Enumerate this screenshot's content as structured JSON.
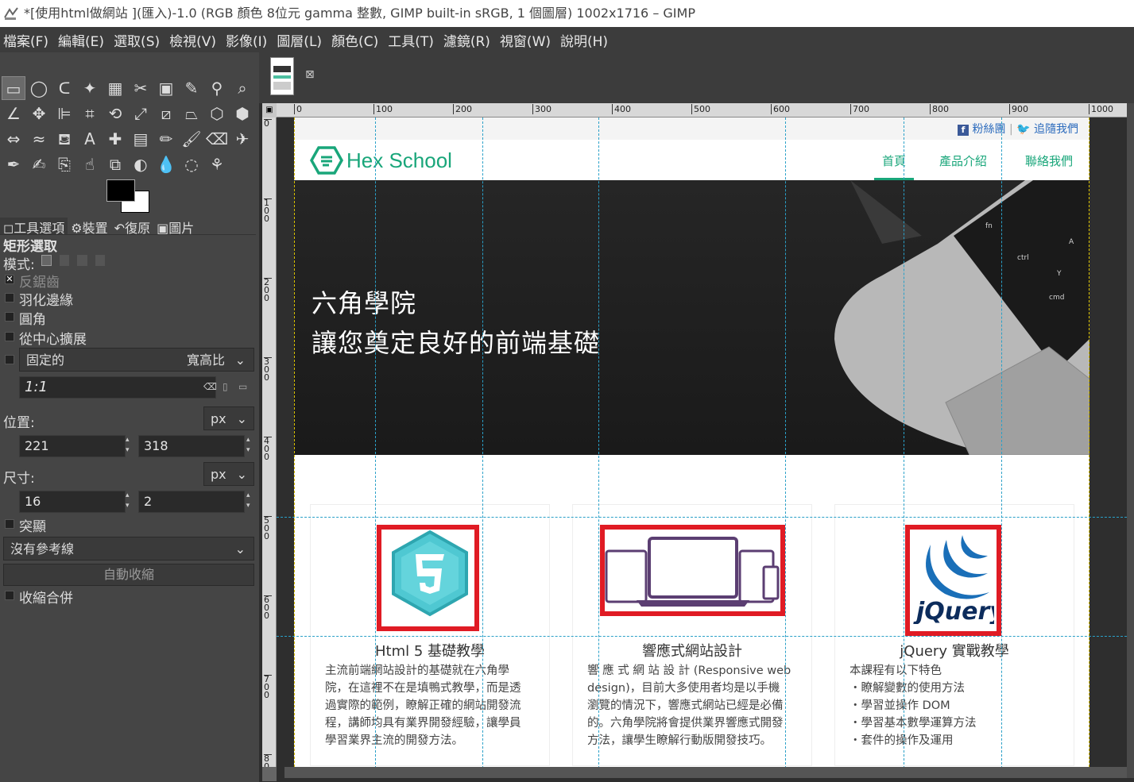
{
  "window": {
    "title": "*[使用html做網站 ](匯入)-1.0 (RGB 顏色 8位元 gamma 整數, GIMP built-in sRGB, 1 個圖層) 1002x1716 – GIMP"
  },
  "menu": [
    "檔案(F)",
    "編輯(E)",
    "選取(S)",
    "檢視(V)",
    "影像(I)",
    "圖層(L)",
    "顏色(C)",
    "工具(T)",
    "濾鏡(R)",
    "視窗(W)",
    "說明(H)"
  ],
  "tools": [
    "rect-select-icon",
    "ellipse-select-icon",
    "lasso-icon",
    "fuzzy-select-icon",
    "color-select-icon",
    "scissors-icon",
    "foreground-select-icon",
    "paths-icon",
    "color-picker-icon",
    "zoom-icon",
    "measure-icon",
    "move-icon",
    "align-icon",
    "crop-icon",
    "rotate-icon",
    "scale-icon",
    "shear-icon",
    "perspective-icon",
    "cage-icon",
    "transform-3d-icon",
    "flip-icon",
    "warp-icon",
    "bucket-fill-icon",
    "text-icon",
    "heal-icon",
    "blend-icon",
    "pencil-icon",
    "paintbrush-icon",
    "eraser-icon",
    "airbrush-icon",
    "ink-icon",
    "mypaint-icon",
    "clone-icon",
    "smudge-icon",
    "perspective-clone-icon",
    "dodge-icon",
    "blur-icon",
    "convolve-icon",
    "smudge2-icon"
  ],
  "dock": {
    "tabs": [
      "工具選項",
      "裝置",
      "復原",
      "圖片"
    ],
    "tool_name": "矩形選取",
    "mode_label": "模式:",
    "antialias": "反鋸齒",
    "feather": "羽化邊緣",
    "rounded": "圓角",
    "expand_center": "從中心擴展",
    "fixed": "固定的",
    "fixed_mode": "寬高比",
    "ratio_value": "1:1",
    "position_label": "位置:",
    "position_unit": "px",
    "pos_x": "221",
    "pos_y": "318",
    "size_label": "尺寸:",
    "size_unit": "px",
    "size_w": "16",
    "size_h": "2",
    "highlight": "突顯",
    "guides": "沒有參考線",
    "auto_shrink": "自動收縮",
    "shrink_merged": "收縮合併"
  },
  "ruler": {
    "h_ticks": [
      "0",
      "100",
      "200",
      "300",
      "400",
      "500",
      "600",
      "700",
      "800",
      "900",
      "1000"
    ],
    "v_ticks": [
      "0",
      "100",
      "200",
      "300",
      "400",
      "500",
      "600",
      "700",
      "800"
    ]
  },
  "site": {
    "social_fb": "粉絲團",
    "social_tw": "追隨我們",
    "logo_text": "Hex School",
    "nav": [
      "首頁",
      "產品介紹",
      "聯絡我們"
    ],
    "hero_line1": "六角學院",
    "hero_line2": "讓您奠定良好的前端基礎",
    "cards": [
      {
        "title": "Html 5 基礎教學",
        "lines": [
          "主流前端網站設計的基礎就在六角學",
          "院，在這裡不在是填鴨式教學，而是透",
          "過實際的範例，瞭解正確的網站開發流",
          "程，講師均具有業界開發經驗，讓學員",
          "學習業界主流的開發方法。"
        ]
      },
      {
        "title": "響應式網站設計",
        "lines": [
          "響 應 式 網 站 設 計 (Responsive web",
          "design)，目前大多使用者均是以手機",
          "瀏覽的情況下，響應式網站已經是必備",
          "的。六角學院將會提供業界響應式開發",
          "方法，讓學生瞭解行動版開發技巧。"
        ]
      },
      {
        "title": "jQuery 實戰教學",
        "lines": [
          "本課程有以下特色",
          "・瞭解變數的使用方法",
          "・學習並操作 DOM",
          "・學習基本數學運算方法",
          "・套件的操作及運用"
        ]
      }
    ],
    "jquery_logo_text": "jQuery",
    "html5_logo_text": "5"
  },
  "colors": {
    "accent": "#19a67a",
    "selection": "#e01b24",
    "guide": "#2aa0c8"
  }
}
